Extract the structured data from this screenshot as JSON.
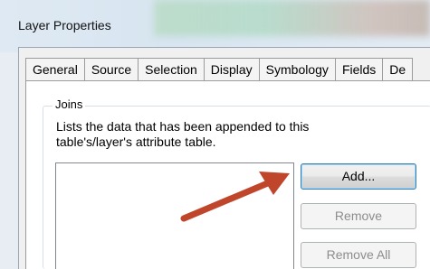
{
  "window": {
    "title": "Layer Properties"
  },
  "tabs": [
    "General",
    "Source",
    "Selection",
    "Display",
    "Symbology",
    "Fields",
    "De"
  ],
  "joins": {
    "group_label": "Joins",
    "description": "Lists the data that has been appended to this table's/layer's attribute table.",
    "buttons": {
      "add": "Add...",
      "remove": "Remove",
      "remove_all": "Remove All"
    }
  },
  "colors": {
    "arrow": "#c0462b"
  }
}
